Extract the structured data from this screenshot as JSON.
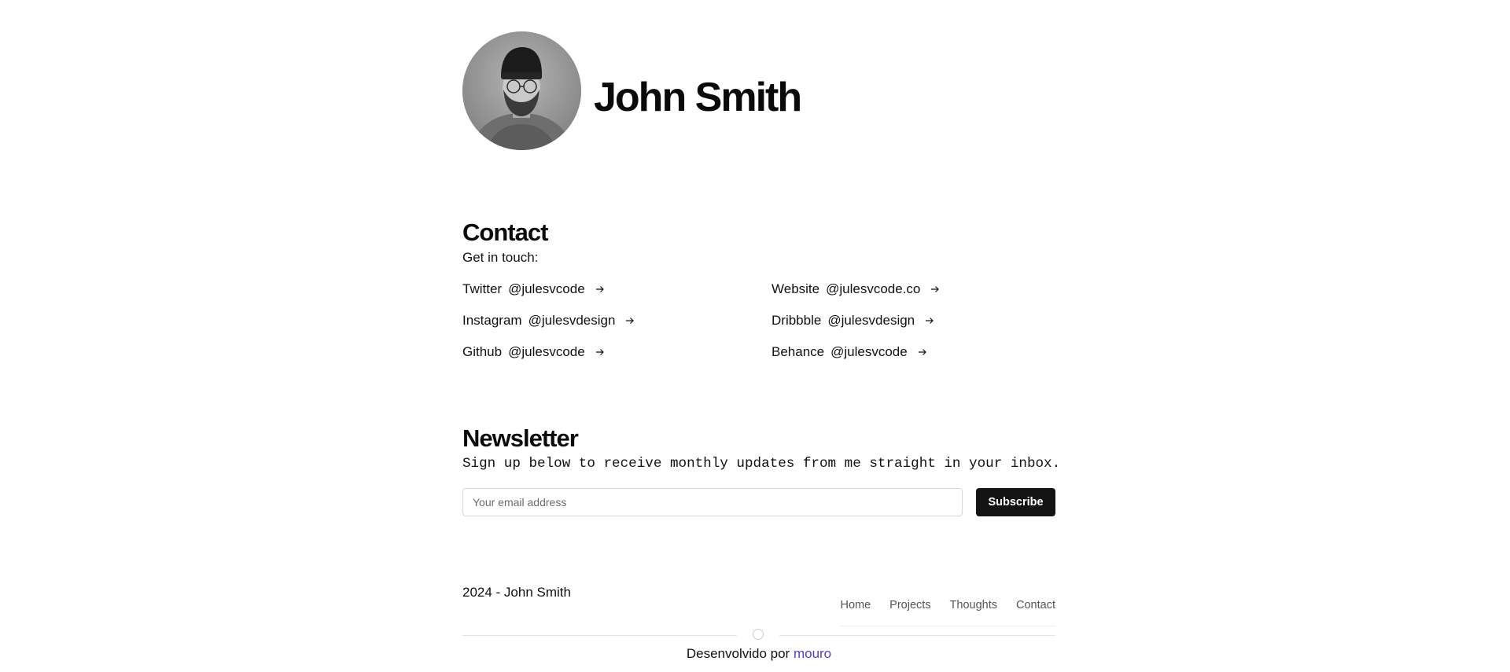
{
  "profile": {
    "name": "John Smith",
    "avatar_alt": "avatar"
  },
  "contact": {
    "title": "Contact",
    "subtitle": "Get in touch:",
    "links": [
      {
        "platform": "Twitter",
        "handle": "@julesvcode",
        "icon": "arrow-right-icon"
      },
      {
        "platform": "Website",
        "handle": "@julesvcode.co",
        "icon": "arrow-right-icon"
      },
      {
        "platform": "Instagram",
        "handle": "@julesvdesign",
        "icon": "arrow-right-icon"
      },
      {
        "platform": "Dribbble",
        "handle": "@julesvdesign",
        "icon": "arrow-right-icon"
      },
      {
        "platform": "Github",
        "handle": "@julesvcode",
        "icon": "arrow-right-icon"
      },
      {
        "platform": "Behance",
        "handle": "@julesvcode",
        "icon": "arrow-right-icon"
      }
    ]
  },
  "newsletter": {
    "title": "Newsletter",
    "description": "Sign up below to receive monthly updates from me straight in your inbox.",
    "input_placeholder": "Your email address",
    "input_value": "",
    "button_label": "Subscribe"
  },
  "footer": {
    "copyright": "2024 - John Smith",
    "nav": [
      "Home",
      "Projects",
      "Thoughts",
      "Contact"
    ],
    "credit_prefix": "Desenvolvido por",
    "credit_link": "mouro"
  },
  "colors": {
    "text": "#111111",
    "button_bg": "#141414",
    "button_text": "#ffffff",
    "link_accent": "#4b3fcf",
    "nav_text": "#555555"
  }
}
